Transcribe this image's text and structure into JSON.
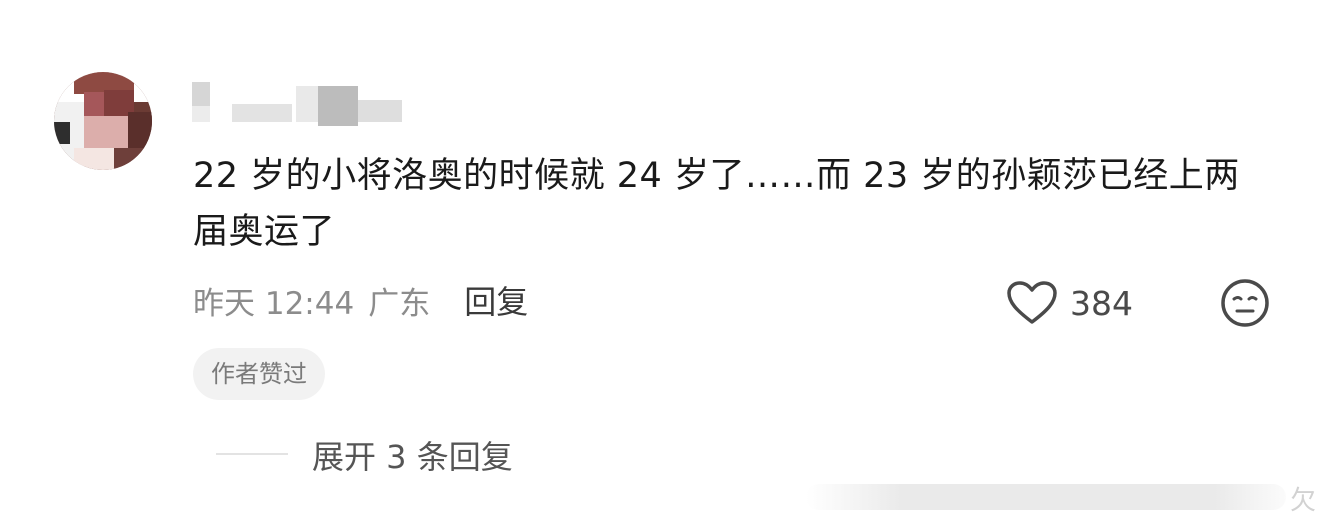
{
  "comment": {
    "text": "22 岁的小将洛奥的时候就 24 岁了……而 23 岁的孙颖莎已经上两届奥运了",
    "time": "昨天 12:44",
    "location": "广东",
    "reply_label": "回复",
    "like_count": "384",
    "author_badge": "作者赞过",
    "expand_replies": "展开 3 条回复"
  },
  "icons": {
    "like": "heart-icon",
    "dislike": "meh-face-icon"
  },
  "colors": {
    "text_primary": "#1a1a1a",
    "text_secondary": "#8c8c8c",
    "badge_bg": "#f2f2f2"
  }
}
